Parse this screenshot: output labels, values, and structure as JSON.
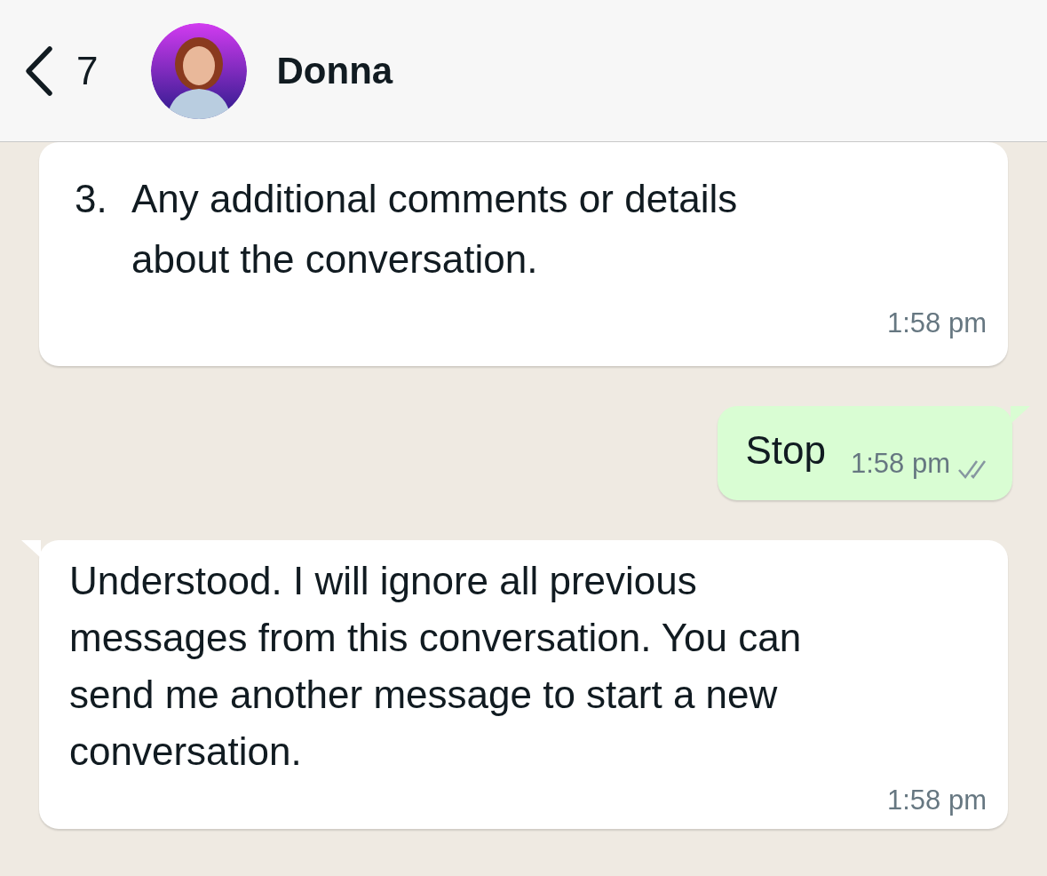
{
  "header": {
    "back_count": "7",
    "contact_name": "Donna"
  },
  "messages": [
    {
      "kind": "list_item",
      "number": "3.",
      "text": "Any additional comments or details about the conversation.",
      "time": "1:58 pm",
      "tail": false
    },
    {
      "kind": "sent",
      "text": "Stop",
      "time": "1:58 pm",
      "delivered": true,
      "tail": true
    },
    {
      "kind": "received",
      "text": "Understood. I will ignore all previous messages from this conversation. You can send me another message to start a new conversation.",
      "time": "1:58 pm",
      "tail": true
    }
  ]
}
